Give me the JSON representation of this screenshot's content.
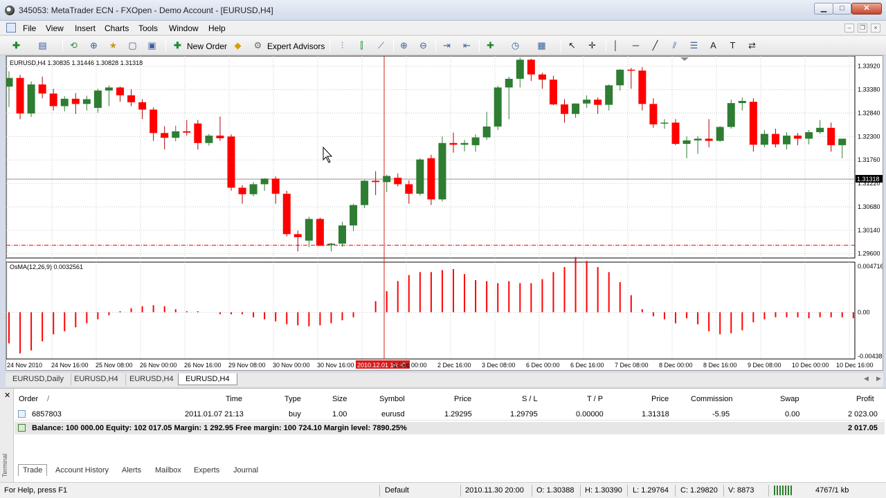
{
  "window": {
    "title": "345053: MetaTrader ECN - FXOpen - Demo Account - [EURUSD,H4]",
    "min_label": "▁",
    "max_label": "□",
    "close_label": "✕"
  },
  "menu": [
    "File",
    "View",
    "Insert",
    "Charts",
    "Tools",
    "Window",
    "Help"
  ],
  "toolbar": {
    "new_order": "New Order",
    "expert_advisors": "Expert Advisors"
  },
  "chart": {
    "symbol_info": "EURUSD,H4  1.30835 1.31446 1.30828 1.31318",
    "indicator_info": "OsMA(12,26,9) 0.0032561",
    "current_price": "1.31318",
    "highlight_date": "2010.12.01 16:00",
    "price_labels": [
      "1.33920",
      "1.33380",
      "1.32840",
      "1.32300",
      "1.31760",
      "1.31220",
      "1.30680",
      "1.30140",
      "1.29600"
    ],
    "osma_labels": [
      "0.004716",
      "0.00",
      "-0.00438"
    ],
    "time_labels": [
      "24 Nov 2010",
      "24 Nov 16:00",
      "25 Nov 08:00",
      "26 Nov 00:00",
      "26 Nov 16:00",
      "29 Nov 08:00",
      "30 Nov 00:00",
      "30 Nov 16:00",
      "2010.12.01 16:00",
      "1 Dec 00:00",
      "2 Dec 16:00",
      "3 Dec 08:00",
      "6 Dec 00:00",
      "6 Dec 16:00",
      "7 Dec 08:00",
      "8 Dec 00:00",
      "8 Dec 16:00",
      "9 Dec 08:00",
      "10 Dec 00:00",
      "10 Dec 16:00"
    ],
    "up_color": "#2e7d32",
    "down_color": "#ff0000"
  },
  "chart_data": {
    "type": "candlestick",
    "price_axis": [
      "1.33920",
      "1.33380",
      "1.32840",
      "1.32300",
      "1.31760",
      "1.31220",
      "1.30680",
      "1.30140",
      "1.29600"
    ],
    "current_price": 1.31318,
    "candles": [
      [
        1.3345,
        1.338,
        1.3298,
        1.3365
      ],
      [
        1.3365,
        1.3372,
        1.327,
        1.3283
      ],
      [
        1.3283,
        1.3357,
        1.3275,
        1.335
      ],
      [
        1.335,
        1.3368,
        1.3318,
        1.3329
      ],
      [
        1.3329,
        1.334,
        1.329,
        1.33
      ],
      [
        1.33,
        1.3323,
        1.3288,
        1.3317
      ],
      [
        1.3317,
        1.333,
        1.3282,
        1.3305
      ],
      [
        1.3305,
        1.3324,
        1.329,
        1.3316
      ],
      [
        1.3296,
        1.334,
        1.3285,
        1.3336
      ],
      [
        1.3336,
        1.3348,
        1.33,
        1.3343
      ],
      [
        1.3343,
        1.3345,
        1.331,
        1.3325
      ],
      [
        1.3325,
        1.3339,
        1.33,
        1.3309
      ],
      [
        1.3309,
        1.3316,
        1.327,
        1.3292
      ],
      [
        1.3292,
        1.3297,
        1.322,
        1.3238
      ],
      [
        1.3238,
        1.3254,
        1.32,
        1.3227
      ],
      [
        1.3227,
        1.3255,
        1.3219,
        1.3242
      ],
      [
        1.3242,
        1.3268,
        1.3232,
        1.3239
      ],
      [
        1.326,
        1.3268,
        1.32,
        1.3215
      ],
      [
        1.3215,
        1.3236,
        1.3209,
        1.3232
      ],
      [
        1.3232,
        1.3276,
        1.322,
        1.3226
      ],
      [
        1.323,
        1.3235,
        1.3105,
        1.3112
      ],
      [
        1.3112,
        1.3118,
        1.3075,
        1.3097
      ],
      [
        1.3097,
        1.3125,
        1.3092,
        1.312
      ],
      [
        1.312,
        1.3134,
        1.3105,
        1.3133
      ],
      [
        1.3133,
        1.3138,
        1.3075,
        1.3098
      ],
      [
        1.3098,
        1.3105,
        1.3,
        1.3005
      ],
      [
        1.3005,
        1.3013,
        1.2965,
        1.2998
      ],
      [
        1.299,
        1.3045,
        1.2975,
        1.304
      ],
      [
        1.304,
        1.3043,
        1.2978,
        1.2978
      ],
      [
        1.298,
        1.2985,
        1.2965,
        1.2983
      ],
      [
        1.2983,
        1.3033,
        1.2976,
        1.3025
      ],
      [
        1.3025,
        1.3075,
        1.3012,
        1.3072
      ],
      [
        1.3072,
        1.313,
        1.3065,
        1.3128
      ],
      [
        1.3128,
        1.315,
        1.3095,
        1.3125
      ],
      [
        1.3125,
        1.3142,
        1.3102,
        1.3139
      ],
      [
        1.3135,
        1.3145,
        1.3115,
        1.312
      ],
      [
        1.312,
        1.3129,
        1.3075,
        1.3098
      ],
      [
        1.3098,
        1.318,
        1.3094,
        1.3177
      ],
      [
        1.318,
        1.3188,
        1.3072,
        1.3085
      ],
      [
        1.3085,
        1.323,
        1.308,
        1.3215
      ],
      [
        1.3215,
        1.3239,
        1.3193,
        1.3211
      ],
      [
        1.3211,
        1.3222,
        1.3196,
        1.3215
      ],
      [
        1.321,
        1.3235,
        1.3195,
        1.3228
      ],
      [
        1.3228,
        1.3287,
        1.3222,
        1.3253
      ],
      [
        1.3253,
        1.3347,
        1.3245,
        1.3343
      ],
      [
        1.3343,
        1.3368,
        1.327,
        1.3363
      ],
      [
        1.3363,
        1.3412,
        1.3343,
        1.3407
      ],
      [
        1.3407,
        1.3409,
        1.3358,
        1.3373
      ],
      [
        1.3373,
        1.3377,
        1.334,
        1.3361
      ],
      [
        1.3361,
        1.337,
        1.3302,
        1.3304
      ],
      [
        1.3304,
        1.3316,
        1.3262,
        1.3282
      ],
      [
        1.3282,
        1.3306,
        1.3273,
        1.3306
      ],
      [
        1.3306,
        1.3325,
        1.3296,
        1.3315
      ],
      [
        1.3315,
        1.332,
        1.3282,
        1.3303
      ],
      [
        1.3303,
        1.335,
        1.329,
        1.3348
      ],
      [
        1.3348,
        1.3385,
        1.3336,
        1.3384
      ],
      [
        1.3384,
        1.3388,
        1.334,
        1.3382
      ],
      [
        1.3382,
        1.339,
        1.329,
        1.3305
      ],
      [
        1.3305,
        1.3318,
        1.325,
        1.3258
      ],
      [
        1.326,
        1.327,
        1.3248,
        1.3262
      ],
      [
        1.3262,
        1.327,
        1.321,
        1.3213
      ],
      [
        1.3213,
        1.323,
        1.318,
        1.3221
      ],
      [
        1.3221,
        1.3231,
        1.319,
        1.3225
      ],
      [
        1.3225,
        1.327,
        1.3205,
        1.322
      ],
      [
        1.322,
        1.3254,
        1.3218,
        1.3252
      ],
      [
        1.3252,
        1.3315,
        1.3248,
        1.3307
      ],
      [
        1.3307,
        1.332,
        1.329,
        1.3312
      ],
      [
        1.331,
        1.3318,
        1.3195,
        1.3211
      ],
      [
        1.3211,
        1.3245,
        1.3205,
        1.3236
      ],
      [
        1.3236,
        1.3248,
        1.3205,
        1.3212
      ],
      [
        1.3212,
        1.324,
        1.32,
        1.3232
      ],
      [
        1.3232,
        1.3238,
        1.321,
        1.3225
      ],
      [
        1.3225,
        1.3245,
        1.3212,
        1.324
      ],
      [
        1.324,
        1.3268,
        1.3236,
        1.325
      ],
      [
        1.325,
        1.3262,
        1.3195,
        1.321
      ],
      [
        1.321,
        1.3224,
        1.318,
        1.3225
      ]
    ],
    "osma_axis": [
      "0.004716",
      "0.00",
      "-0.00438"
    ],
    "osma": [
      -0.0031,
      -0.0041,
      -0.0038,
      -0.0029,
      -0.0022,
      -0.0019,
      -0.0015,
      -0.0011,
      -0.0007,
      -0.0003,
      0.0001,
      0.0004,
      0.0006,
      0.0007,
      0.0006,
      0.0003,
      0.0001,
      0.0001,
      0.0,
      -0.0002,
      -0.0002,
      -0.0002,
      -0.0005,
      -0.0007,
      -0.0009,
      -0.0012,
      -0.0013,
      -0.0014,
      -0.0013,
      -0.0011,
      -0.0008,
      -0.0005,
      0.0,
      0.0011,
      0.0021,
      0.0031,
      0.0037,
      0.004,
      0.004,
      0.0042,
      0.0043,
      0.0038,
      0.0032,
      0.0031,
      0.0029,
      0.0031,
      0.0029,
      0.0029,
      0.0033,
      0.004,
      0.0045,
      0.0055,
      0.0051,
      0.0045,
      0.004,
      0.003,
      0.0017,
      0.0003,
      -0.0004,
      -0.0007,
      -0.0011,
      -0.0006,
      -0.0012,
      -0.0019,
      -0.0022,
      -0.0021,
      -0.0018,
      -0.001,
      -0.0007,
      -0.0005,
      -0.0005,
      -0.0005,
      -0.0006,
      -0.0005,
      -0.0005,
      -0.0005,
      -0.0006
    ]
  },
  "chart_tabs": [
    "EURUSD,Daily",
    "EURUSD,H4",
    "EURUSD,H4",
    "EURUSD,H4"
  ],
  "terminal": {
    "side_label": "Terminal",
    "columns": {
      "order": "Order",
      "sort": "/",
      "time": "Time",
      "type": "Type",
      "size": "Size",
      "symbol": "Symbol",
      "price": "Price",
      "sl": "S / L",
      "tp": "T / P",
      "price2": "Price",
      "commission": "Commission",
      "swap": "Swap",
      "profit": "Profit"
    },
    "order": {
      "id": "6857803",
      "time": "2011.01.07 21:13",
      "type": "buy",
      "size": "1.00",
      "symbol": "eurusd",
      "price": "1.29295",
      "sl": "1.29795",
      "tp": "0.00000",
      "price2": "1.31318",
      "commission": "-5.95",
      "swap": "0.00",
      "profit": "2 023.00"
    },
    "balance_line": "Balance: 100 000.00  Equity: 102 017.05  Margin: 1 292.95  Free margin: 100 724.10  Margin level: 7890.25%",
    "balance_profit": "2 017.05",
    "tabs": [
      "Trade",
      "Account History",
      "Alerts",
      "Mailbox",
      "Experts",
      "Journal"
    ]
  },
  "status": {
    "help": "For Help, press F1",
    "profile": "Default",
    "datetime": "2010.11.30 20:00",
    "open": "O: 1.30388",
    "high": "H: 1.30390",
    "low": "L: 1.29764",
    "close": "C: 1.29820",
    "volume": "V: 8873",
    "traffic": "4767/1 kb"
  }
}
